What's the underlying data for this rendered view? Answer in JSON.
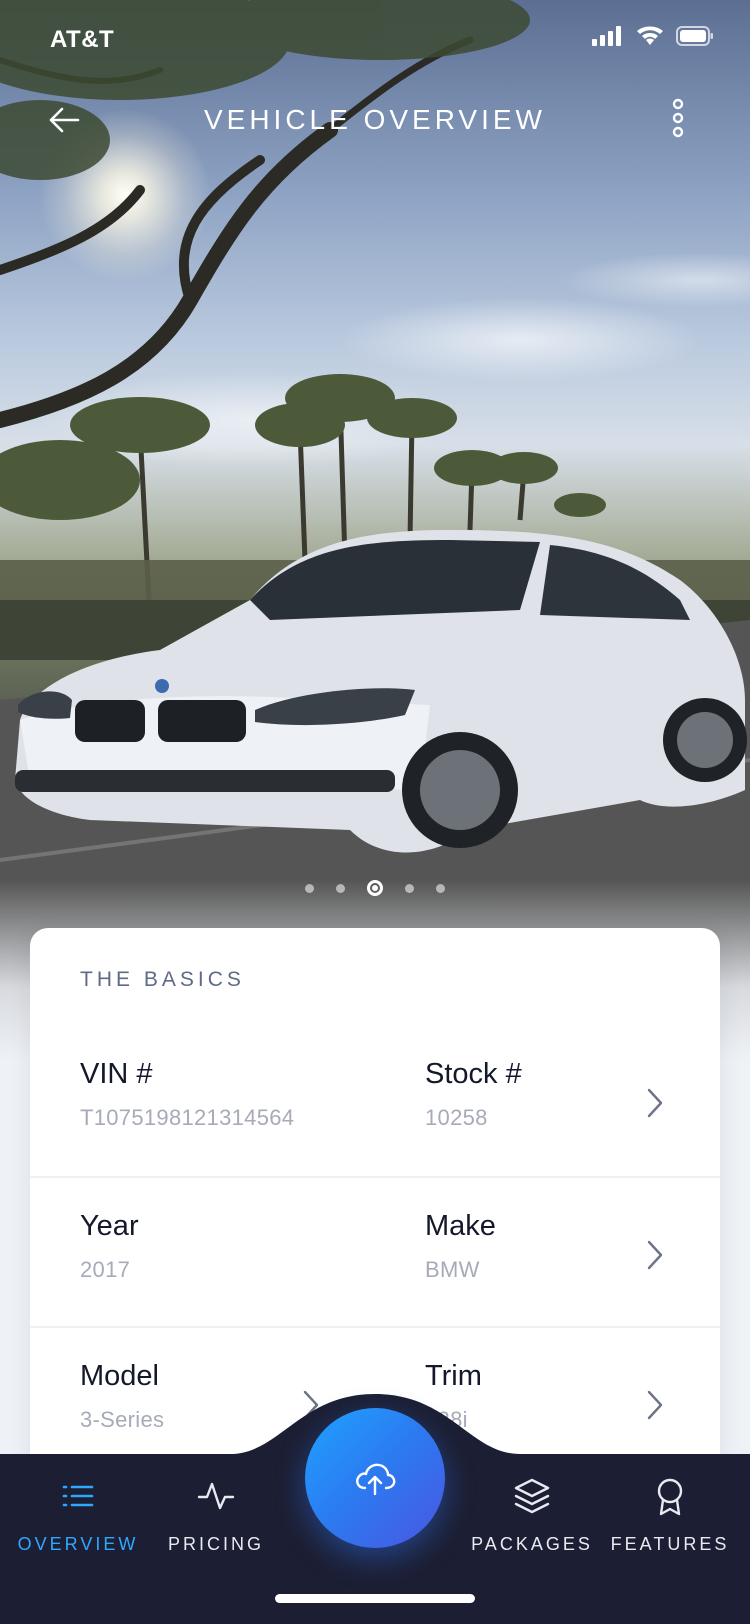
{
  "status_bar": {
    "carrier": "AT&T",
    "icons": [
      "signal-icon",
      "wifi-icon",
      "battery-icon"
    ]
  },
  "nav": {
    "title": "VEHICLE OVERVIEW",
    "back_icon": "back-arrow-icon",
    "more_icon": "more-vertical-icon"
  },
  "gallery": {
    "image": "white BMW 3-Series sedan driving on palm-lined road",
    "total_slides": 5,
    "active_index": 2
  },
  "basics": {
    "header": "THE BASICS",
    "rows": [
      {
        "left": {
          "label": "VIN #",
          "value": "T1075198121314564"
        },
        "right": {
          "label": "Stock #",
          "value": "10258"
        }
      },
      {
        "left": {
          "label": "Year",
          "value": "2017"
        },
        "right": {
          "label": "Make",
          "value": "BMW"
        }
      },
      {
        "left": {
          "label": "Model",
          "value": "3-Series"
        },
        "right": {
          "label": "Trim",
          "value": "328i"
        }
      }
    ]
  },
  "tabbar": {
    "tabs": [
      {
        "label": "OVERVIEW",
        "icon": "list-icon",
        "active": true
      },
      {
        "label": "PRICING",
        "icon": "pulse-icon",
        "active": false
      },
      {
        "label": "PACKAGES",
        "icon": "layers-icon",
        "active": false
      },
      {
        "label": "FEATURES",
        "icon": "award-icon",
        "active": false
      }
    ],
    "fab_icon": "cloud-upload-icon"
  },
  "colors": {
    "accent": "#2fa7ff",
    "tabbar_bg": "#1c1f33",
    "fab_start": "#1ea2ff",
    "fab_end": "#4a56e2",
    "label": "#14182b",
    "value": "#a7abb8"
  }
}
